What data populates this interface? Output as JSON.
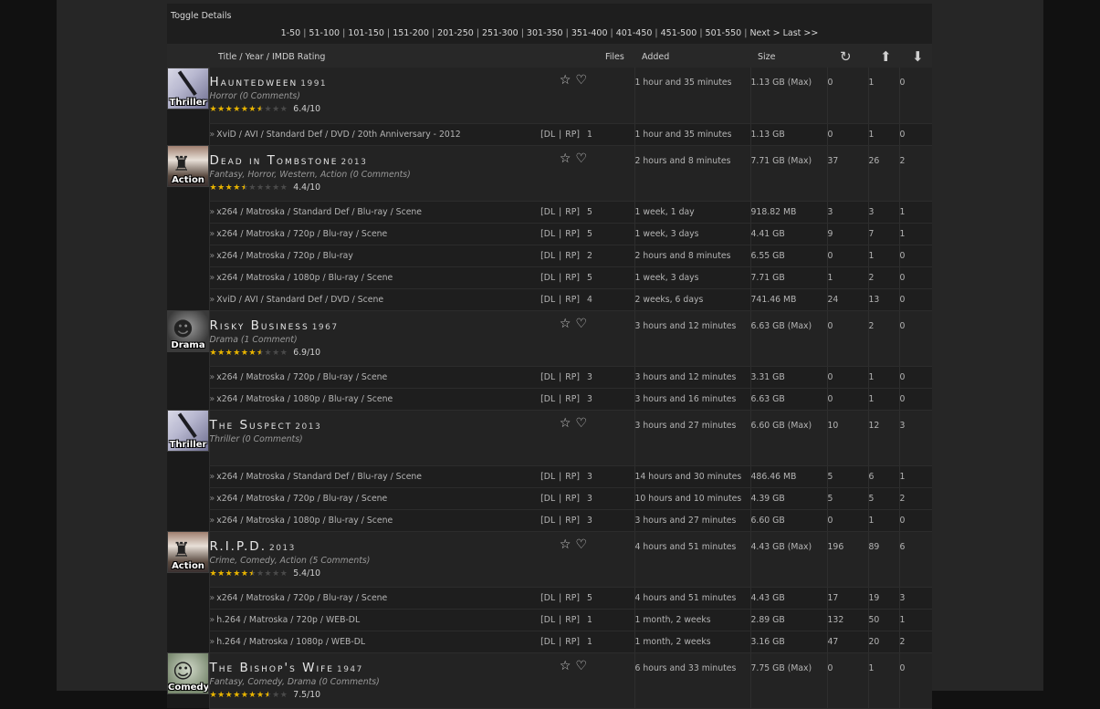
{
  "toggle_details": "Toggle Details",
  "pager": [
    "1-50",
    "51-100",
    "101-150",
    "151-200",
    "201-250",
    "251-300",
    "301-350",
    "351-400",
    "401-450",
    "451-500",
    "501-550",
    "Next >",
    "Last >>"
  ],
  "headers": {
    "title": "Title / Year / IMDB Rating",
    "files": "Files",
    "added": "Added",
    "size": "Size"
  },
  "dl_rp": {
    "dl": "DL",
    "rp": "RP",
    "sep": "|"
  },
  "movies": [
    {
      "title": "Hauntedween",
      "year": "1991",
      "genres": "Horror",
      "comments": "(0 Comments)",
      "rating_stars": 6.4,
      "score": "6.4/10",
      "genre_label": "Thriller",
      "poster": "thriller",
      "added": "1 hour and 35 minutes",
      "size": "1.13 GB (Max)",
      "snatched": "0",
      "seeders": "1",
      "leechers": "0",
      "releases": [
        {
          "name": "XviD / AVI / Standard Def / DVD / 20th Anniversary - 2012",
          "files": "1",
          "added": "1 hour and 35 minutes",
          "size": "1.13 GB",
          "snatched": "0",
          "seeders": "1",
          "leechers": "0"
        }
      ]
    },
    {
      "title": "Dead in Tombstone",
      "year": "2013",
      "genres": "Fantasy, Horror, Western, Action",
      "comments": "(0 Comments)",
      "rating_stars": 4.4,
      "score": "4.4/10",
      "genre_label": "Action",
      "poster": "action",
      "added": "2 hours and 8 minutes",
      "size": "7.71 GB (Max)",
      "snatched": "37",
      "seeders": "26",
      "leechers": "2",
      "releases": [
        {
          "name": "x264 / Matroska / Standard Def / Blu-ray / Scene",
          "files": "5",
          "added": "1 week, 1 day",
          "size": "918.82 MB",
          "snatched": "3",
          "seeders": "3",
          "leechers": "1"
        },
        {
          "name": "x264 / Matroska / 720p / Blu-ray / Scene",
          "files": "5",
          "added": "1 week, 3 days",
          "size": "4.41 GB",
          "snatched": "9",
          "seeders": "7",
          "leechers": "1"
        },
        {
          "name": "x264 / Matroska / 720p / Blu-ray",
          "files": "2",
          "added": "2 hours and 8 minutes",
          "size": "6.55 GB",
          "snatched": "0",
          "seeders": "1",
          "leechers": "0"
        },
        {
          "name": "x264 / Matroska / 1080p / Blu-ray / Scene",
          "files": "5",
          "added": "1 week, 3 days",
          "size": "7.71 GB",
          "snatched": "1",
          "seeders": "2",
          "leechers": "0"
        },
        {
          "name": "XviD / AVI / Standard Def / DVD / Scene",
          "files": "4",
          "added": "2 weeks, 6 days",
          "size": "741.46 MB",
          "snatched": "24",
          "seeders": "13",
          "leechers": "0"
        }
      ]
    },
    {
      "title": "Risky Business",
      "year": "1967",
      "genres": "Drama",
      "comments": "(1 Comment)",
      "rating_stars": 6.9,
      "score": "6.9/10",
      "genre_label": "Drama",
      "poster": "drama",
      "added": "3 hours and 12 minutes",
      "size": "6.63 GB (Max)",
      "snatched": "0",
      "seeders": "2",
      "leechers": "0",
      "releases": [
        {
          "name": "x264 / Matroska / 720p / Blu-ray / Scene",
          "files": "3",
          "added": "3 hours and 12 minutes",
          "size": "3.31 GB",
          "snatched": "0",
          "seeders": "1",
          "leechers": "0"
        },
        {
          "name": "x264 / Matroska / 1080p / Blu-ray / Scene",
          "files": "3",
          "added": "3 hours and 16 minutes",
          "size": "6.63 GB",
          "snatched": "0",
          "seeders": "1",
          "leechers": "0"
        }
      ]
    },
    {
      "title": "The Suspect",
      "year": "2013",
      "genres": "Thriller",
      "comments": "(0 Comments)",
      "rating_stars": null,
      "score": "",
      "genre_label": "Thriller",
      "poster": "thriller",
      "added": "3 hours and 27 minutes",
      "size": "6.60 GB (Max)",
      "snatched": "10",
      "seeders": "12",
      "leechers": "3",
      "releases": [
        {
          "name": "x264 / Matroska / Standard Def / Blu-ray / Scene",
          "files": "3",
          "added": "14 hours and 30 minutes",
          "size": "486.46 MB",
          "snatched": "5",
          "seeders": "6",
          "leechers": "1"
        },
        {
          "name": "x264 / Matroska / 720p / Blu-ray / Scene",
          "files": "3",
          "added": "10 hours and 10 minutes",
          "size": "4.39 GB",
          "snatched": "5",
          "seeders": "5",
          "leechers": "2"
        },
        {
          "name": "x264 / Matroska / 1080p / Blu-ray / Scene",
          "files": "3",
          "added": "3 hours and 27 minutes",
          "size": "6.60 GB",
          "snatched": "0",
          "seeders": "1",
          "leechers": "0"
        }
      ]
    },
    {
      "title": "R.I.P.D.",
      "year": "2013",
      "genres": "Crime, Comedy, Action",
      "comments": "(5 Comments)",
      "rating_stars": 5.4,
      "score": "5.4/10",
      "genre_label": "Action",
      "poster": "action",
      "added": "4 hours and 51 minutes",
      "size": "4.43 GB (Max)",
      "snatched": "196",
      "seeders": "89",
      "leechers": "6",
      "releases": [
        {
          "name": "x264 / Matroska / 720p / Blu-ray / Scene",
          "files": "5",
          "added": "4 hours and 51 minutes",
          "size": "4.43 GB",
          "snatched": "17",
          "seeders": "19",
          "leechers": "3"
        },
        {
          "name": "h.264 / Matroska / 720p / WEB-DL",
          "files": "1",
          "added": "1 month, 2 weeks",
          "size": "2.89 GB",
          "snatched": "132",
          "seeders": "50",
          "leechers": "1"
        },
        {
          "name": "h.264 / Matroska / 1080p / WEB-DL",
          "files": "1",
          "added": "1 month, 2 weeks",
          "size": "3.16 GB",
          "snatched": "47",
          "seeders": "20",
          "leechers": "2"
        }
      ]
    },
    {
      "title": "The Bishop's Wife",
      "year": "1947",
      "genres": "Fantasy, Comedy, Drama",
      "comments": "(0 Comments)",
      "rating_stars": 7.5,
      "score": "7.5/10",
      "genre_label": "Comedy",
      "poster": "comedy",
      "added": "6 hours and 33 minutes",
      "size": "7.75 GB (Max)",
      "snatched": "0",
      "seeders": "1",
      "leechers": "0",
      "releases": []
    }
  ]
}
